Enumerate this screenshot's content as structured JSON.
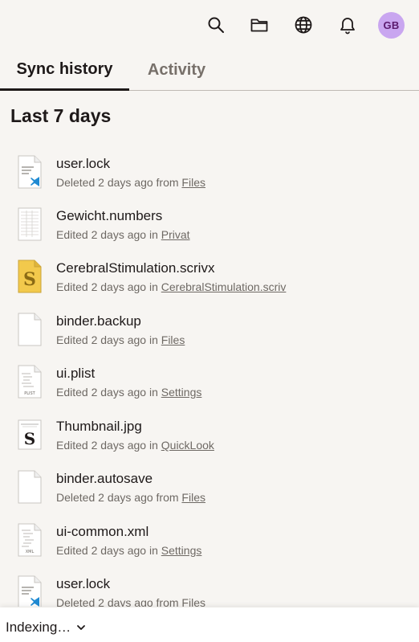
{
  "header": {
    "icons": [
      "search-icon",
      "folder-icon",
      "globe-icon",
      "bell-icon"
    ],
    "avatar_initials": "GB",
    "avatar_color": "#c9a6f0"
  },
  "tabs": [
    {
      "label": "Sync history",
      "active": true
    },
    {
      "label": "Activity",
      "active": false
    }
  ],
  "section_title": "Last 7 days",
  "items": [
    {
      "name": "user.lock",
      "meta": "Deleted 2 days ago from ",
      "location": "Files",
      "icon": "vscode-doc-icon"
    },
    {
      "name": "Gewicht.numbers",
      "meta": "Edited 2 days ago in ",
      "location": "Privat",
      "icon": "spreadsheet-icon"
    },
    {
      "name": "CerebralStimulation.scrivx",
      "meta": "Edited 2 days ago in ",
      "location": "CerebralStimulation.scriv",
      "icon": "scrivener-icon"
    },
    {
      "name": "binder.backup",
      "meta": "Edited 2 days ago in ",
      "location": "Files",
      "icon": "blank-file-icon"
    },
    {
      "name": "ui.plist",
      "meta": "Edited 2 days ago in ",
      "location": "Settings",
      "icon": "plist-file-icon"
    },
    {
      "name": "Thumbnail.jpg",
      "meta": "Edited 2 days ago in ",
      "location": "QuickLook",
      "icon": "image-thumbnail-icon"
    },
    {
      "name": "binder.autosave",
      "meta": "Deleted 2 days ago from ",
      "location": "Files",
      "icon": "blank-file-icon"
    },
    {
      "name": "ui-common.xml",
      "meta": "Edited 2 days ago in ",
      "location": "Settings",
      "icon": "xml-file-icon"
    },
    {
      "name": "user.lock",
      "meta": "Deleted 2 days ago from ",
      "location": "Files",
      "icon": "vscode-doc-icon"
    }
  ],
  "footer": {
    "status": "Indexing…"
  }
}
